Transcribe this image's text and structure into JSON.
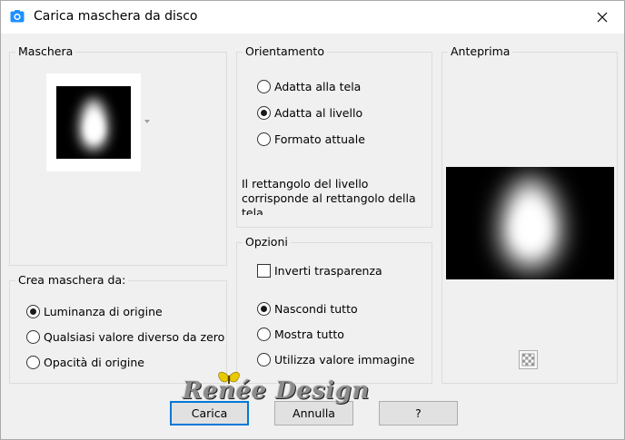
{
  "window": {
    "title": "Carica maschera da disco"
  },
  "maschera": {
    "label": "Maschera"
  },
  "crea_maschera": {
    "label": "Crea maschera da:",
    "options": [
      {
        "label": "Luminanza di origine",
        "selected": true
      },
      {
        "label": "Qualsiasi valore diverso da zero",
        "selected": false
      },
      {
        "label": "Opacità di origine",
        "selected": false
      }
    ]
  },
  "orientamento": {
    "label": "Orientamento",
    "options": [
      {
        "label": "Adatta alla tela",
        "selected": false
      },
      {
        "label": "Adatta al livello",
        "selected": true
      },
      {
        "label": "Formato attuale",
        "selected": false
      }
    ],
    "info": "Il rettangolo del livello corrisponde al rettangolo della tela"
  },
  "opzioni": {
    "label": "Opzioni",
    "invert_label": "Inverti trasparenza",
    "invert_checked": false,
    "options": [
      {
        "label": "Nascondi tutto",
        "selected": true
      },
      {
        "label": "Mostra tutto",
        "selected": false
      },
      {
        "label": "Utilizza valore immagine",
        "selected": false
      }
    ]
  },
  "anteprima": {
    "label": "Anteprima"
  },
  "buttons": {
    "load": "Carica",
    "cancel": "Annulla",
    "help": "?"
  },
  "watermark": {
    "text": "Renée Design"
  },
  "colors": {
    "accent": "#0078d7",
    "background": "#f0f0f0",
    "group_border": "#dcdcdc"
  }
}
